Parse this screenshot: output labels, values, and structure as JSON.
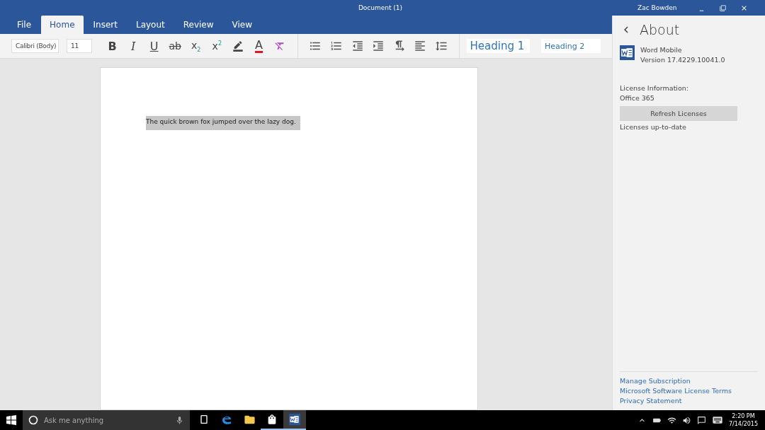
{
  "window": {
    "title": "Document (1)",
    "user": "Zac Bowden"
  },
  "tabs": [
    {
      "label": "File",
      "selected": false
    },
    {
      "label": "Home",
      "selected": true
    },
    {
      "label": "Insert",
      "selected": false
    },
    {
      "label": "Layout",
      "selected": false
    },
    {
      "label": "Review",
      "selected": false
    },
    {
      "label": "View",
      "selected": false
    }
  ],
  "ribbon": {
    "font": "Calibri (Body)",
    "size": "11",
    "format_buttons": [
      {
        "kind": "bold",
        "label": "B"
      },
      {
        "kind": "italic",
        "label": "I"
      },
      {
        "kind": "underline",
        "label": "U"
      },
      {
        "kind": "strikethrough",
        "label": "ab"
      },
      {
        "kind": "subscript",
        "label": "x$_{2}$"
      },
      {
        "kind": "superscript",
        "label": "x$^{2}$"
      },
      {
        "kind": "highlight"
      },
      {
        "kind": "font_color",
        "label": "A"
      },
      {
        "kind": "clear"
      }
    ],
    "paragraph_buttons": [
      {
        "kind": "bullets"
      },
      {
        "kind": "numbering"
      },
      {
        "kind": "outdent"
      },
      {
        "kind": "indent"
      },
      {
        "kind": "direction"
      },
      {
        "kind": "align"
      },
      {
        "kind": "spacing"
      }
    ],
    "styles": [
      {
        "kind": "heading1",
        "label": "Heading 1"
      },
      {
        "kind": "heading2",
        "label": "Heading 2"
      }
    ]
  },
  "document": {
    "text": "The quick brown fox jumped over the lazy dog.",
    "selected": true
  },
  "about_panel": {
    "title": "About",
    "app_name": "Word Mobile",
    "version": "Version 17.4229.10041.0",
    "license_label": "License Information:",
    "license": "Office 365",
    "refresh_button": "Refresh Licenses",
    "status": "Licenses up-to-date",
    "links": [
      "Manage Subscription",
      "Microsoft Software License Terms",
      "Privacy Statement"
    ]
  },
  "taskbar": {
    "search_placeholder": "Ask me anything",
    "apps": [
      {
        "kind": "task_view",
        "running": false,
        "active": false
      },
      {
        "kind": "browser",
        "running": false,
        "active": false
      },
      {
        "kind": "folder",
        "running": false,
        "active": false
      },
      {
        "kind": "store",
        "running": true,
        "active": false
      },
      {
        "kind": "word",
        "running": true,
        "active": true
      }
    ],
    "time": "2:20 PM",
    "date": "7/14/2015"
  }
}
